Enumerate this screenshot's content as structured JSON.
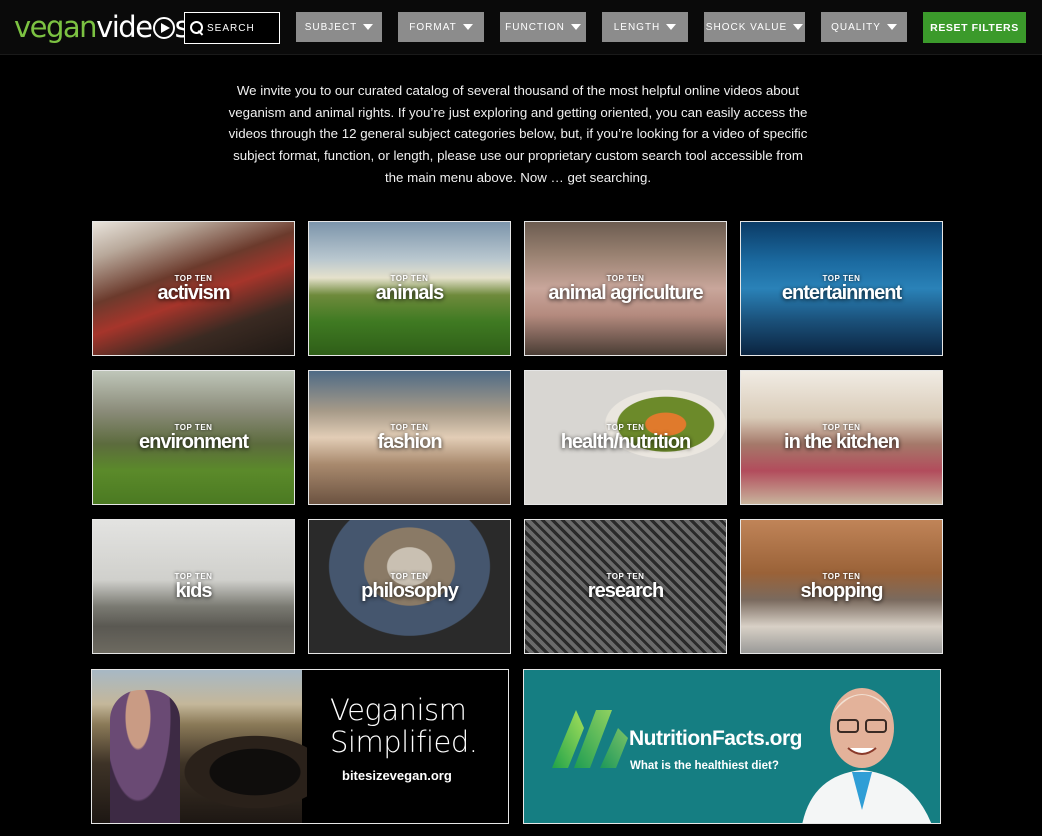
{
  "logo": {
    "part1": "vegan",
    "part2": "vide",
    "part3": "s"
  },
  "search": {
    "placeholder": "SEARCH"
  },
  "filters": [
    {
      "label": "SUBJECT"
    },
    {
      "label": "FORMAT"
    },
    {
      "label": "FUNCTION"
    },
    {
      "label": "LENGTH"
    },
    {
      "label": "SHOCK VALUE"
    },
    {
      "label": "QUALITY"
    }
  ],
  "reset_label": "RESET FILTERS",
  "intro": "We invite you to our curated catalog of several thousand of the most helpful online videos about veganism and animal rights. If you’re just exploring and getting oriented, you can easily access the videos through the 12 general subject categories below, but, if you’re looking for a video of specific subject format, function, or length, please use our proprietary custom search tool accessible from the main menu above. Now … get searching.",
  "tile_prefix": "TOP TEN",
  "categories": [
    {
      "name": "activism"
    },
    {
      "name": "animals"
    },
    {
      "name": "animal agriculture"
    },
    {
      "name": "entertainment"
    },
    {
      "name": "environment"
    },
    {
      "name": "fashion"
    },
    {
      "name": "health/nutrition"
    },
    {
      "name": "in the kitchen"
    },
    {
      "name": "kids"
    },
    {
      "name": "philosophy"
    },
    {
      "name": "research"
    },
    {
      "name": "shopping"
    }
  ],
  "ads": {
    "left": {
      "headline1": "Veganism",
      "headline2": "Simplified.",
      "url": "bitesizevegan.org"
    },
    "right": {
      "brand": "NutritionFacts.org",
      "tagline": "What is the healthiest diet?"
    }
  },
  "colors": {
    "accent_green": "#7cc242",
    "reset_green": "#3b9a2b",
    "filter_gray": "#8c8c8c",
    "ad_teal": "#157e82"
  }
}
